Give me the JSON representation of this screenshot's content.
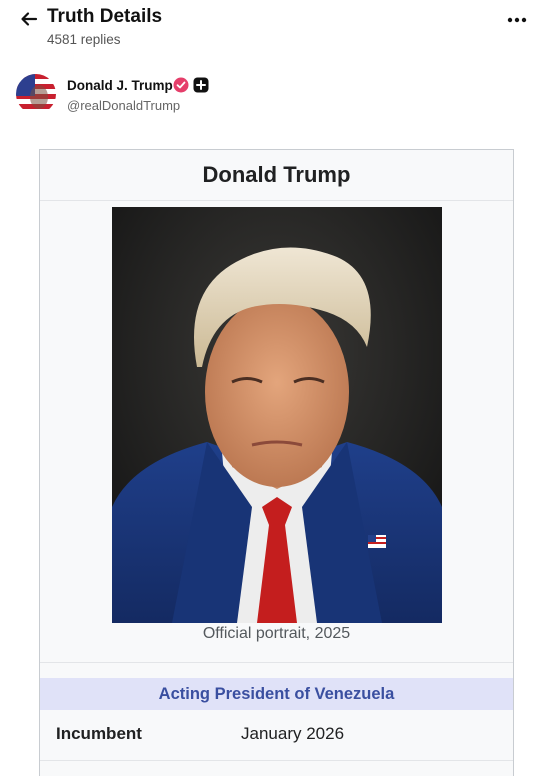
{
  "header": {
    "title": "Truth Details",
    "replies": "4581 replies",
    "back_icon": "arrow-left-icon",
    "more_icon": "more-horizontal-icon"
  },
  "author": {
    "name": "Donald J. Trump",
    "handle": "@realDonaldTrump",
    "verified_icon": "verified-badge-icon",
    "plus_icon": "plus-badge-icon",
    "verified_color": "#e53e6a"
  },
  "infobox": {
    "title": "Donald Trump",
    "caption": "Official portrait, 2025",
    "office": "Acting President of Venezuela",
    "incumbent_label": "Incumbent",
    "incumbent_value": "January 2026",
    "office_bg": "#e0e2f8",
    "office_color": "#3a4fa0"
  }
}
